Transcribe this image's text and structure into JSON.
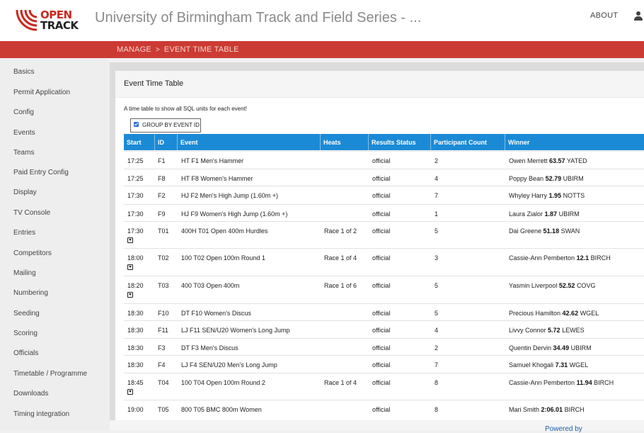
{
  "header": {
    "logo_line1": "OPEN",
    "logo_line2": "TRACK",
    "site_title": "University of Birmingham Track and Field Series - ...",
    "about_label": "ABOUT"
  },
  "breadcrumb": {
    "manage": "MANAGE",
    "separator": ">",
    "current": "EVENT TIME TABLE"
  },
  "sidebar": {
    "items": [
      "Basics",
      "Permit Application",
      "Config",
      "Events",
      "Teams",
      "Paid Entry Config",
      "Display",
      "TV Console",
      "Entries",
      "Competitors",
      "Mailing",
      "Numbering",
      "Seeding",
      "Scoring",
      "Officials",
      "Timetable / Programme",
      "Downloads",
      "Timing integration"
    ]
  },
  "panel": {
    "title": "Event Time Table",
    "description": "A time table to show all SQL units for each event!",
    "group_checkbox_label": "GROUP BY EVENT ID",
    "group_checked": true
  },
  "table": {
    "headers": {
      "start": "Start",
      "id": "ID",
      "event": "Event",
      "heats": "Heats",
      "results_status": "Results Status",
      "participant_count": "Participant Count",
      "winner": "Winner"
    },
    "rows": [
      {
        "start": "17:25",
        "id": "F1",
        "event": "HT F1 Men's Hammer",
        "heats": "",
        "status": "official",
        "count": "2",
        "winner_name": "Owen Merrett",
        "winner_mark": "63.57",
        "winner_team": "YATED",
        "expandable": false
      },
      {
        "start": "17:25",
        "id": "F8",
        "event": "HT F8 Women's Hammer",
        "heats": "",
        "status": "official",
        "count": "4",
        "winner_name": "Poppy Bean",
        "winner_mark": "52.79",
        "winner_team": "UBIRM",
        "expandable": false
      },
      {
        "start": "17:30",
        "id": "F2",
        "event": "HJ F2 Men's High Jump (1.60m +)",
        "heats": "",
        "status": "official",
        "count": "7",
        "winner_name": "Whyley Harry",
        "winner_mark": "1.95",
        "winner_team": "NOTTS",
        "expandable": false
      },
      {
        "start": "17:30",
        "id": "F9",
        "event": "HJ F9 Women's High Jump (1.60m +)",
        "heats": "",
        "status": "official",
        "count": "1",
        "winner_name": "Laura Zialor",
        "winner_mark": "1.87",
        "winner_team": "UBIRM",
        "expandable": false
      },
      {
        "start": "17:30",
        "id": "T01",
        "event": "400H T01 Open 400m Hurdles",
        "heats": "Race 1 of 2",
        "status": "official",
        "count": "5",
        "winner_name": "Dai Greene",
        "winner_mark": "51.18",
        "winner_team": "SWAN",
        "expandable": true
      },
      {
        "start": "18:00",
        "id": "T02",
        "event": "100 T02 Open 100m Round 1",
        "heats": "Race 1 of 4",
        "status": "official",
        "count": "3",
        "winner_name": "Cassie-Ann Pemberton",
        "winner_mark": "12.1",
        "winner_team": "BIRCH",
        "expandable": true
      },
      {
        "start": "18:20",
        "id": "T03",
        "event": "400 T03 Open 400m",
        "heats": "Race 1 of 6",
        "status": "official",
        "count": "5",
        "winner_name": "Yasmin Liverpool",
        "winner_mark": "52.52",
        "winner_team": "COVG",
        "expandable": true
      },
      {
        "start": "18:30",
        "id": "F10",
        "event": "DT F10 Women's Discus",
        "heats": "",
        "status": "official",
        "count": "5",
        "winner_name": "Precious Hamilton",
        "winner_mark": "42.62",
        "winner_team": "WGEL",
        "expandable": false
      },
      {
        "start": "18:30",
        "id": "F11",
        "event": "LJ F11 SEN/U20 Women's Long Jump",
        "heats": "",
        "status": "official",
        "count": "4",
        "winner_name": "Livvy Connor",
        "winner_mark": "5.72",
        "winner_team": "LEWES",
        "expandable": false
      },
      {
        "start": "18:30",
        "id": "F3",
        "event": "DT F3 Men's Discus",
        "heats": "",
        "status": "official",
        "count": "2",
        "winner_name": "Quentin Dervin",
        "winner_mark": "34.49",
        "winner_team": "UBIRM",
        "expandable": false
      },
      {
        "start": "18:30",
        "id": "F4",
        "event": "LJ F4 SEN/U20 Men's Long Jump",
        "heats": "",
        "status": "official",
        "count": "7",
        "winner_name": "Samuel Khogali",
        "winner_mark": "7.31",
        "winner_team": "WGEL",
        "expandable": false
      },
      {
        "start": "18:45",
        "id": "T04",
        "event": "100 T04 Open 100m Round 2",
        "heats": "Race 1 of 4",
        "status": "official",
        "count": "8",
        "winner_name": "Cassie-Ann Pemberton",
        "winner_mark": "11.94",
        "winner_team": "BIRCH",
        "expandable": true
      },
      {
        "start": "19:00",
        "id": "T05",
        "event": "800 T05 BMC 800m Women",
        "heats": "",
        "status": "official",
        "count": "8",
        "winner_name": "Mari Smith",
        "winner_mark": "2:06.01",
        "winner_team": "BIRCH",
        "expandable": false
      }
    ]
  },
  "footer": {
    "powered_text": "Powered by"
  },
  "colors": {
    "brand_red": "#cc3b33",
    "table_header_blue": "#1b8ad6"
  },
  "icons": [
    "open-track-logo-icon",
    "user-icon",
    "chevron-right-icon",
    "checkbox-checked-icon",
    "expand-icon"
  ]
}
